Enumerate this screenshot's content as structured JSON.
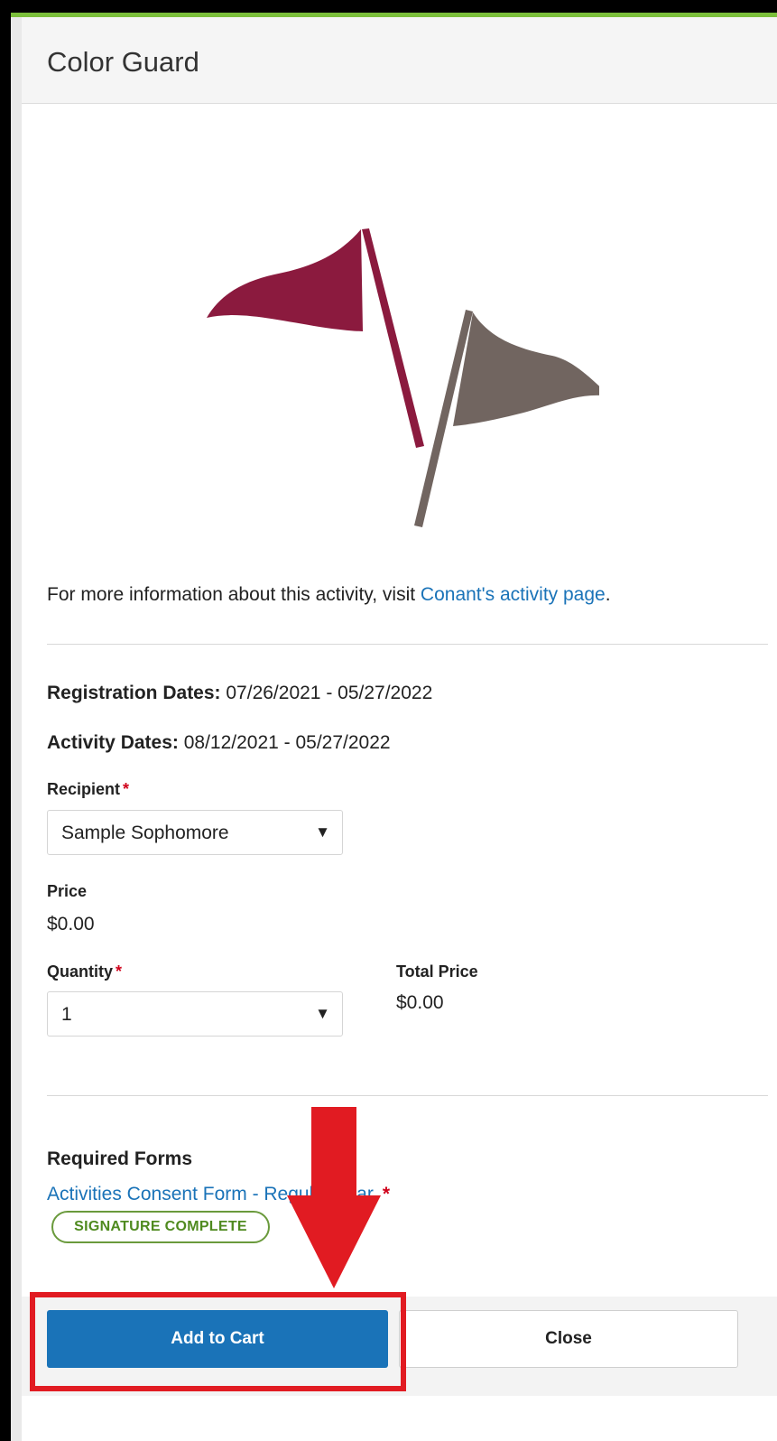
{
  "modal": {
    "title": "Color Guard",
    "info_prefix": "For more information about this activity, visit ",
    "info_link": "Conant's activity page",
    "info_suffix": "."
  },
  "registration": {
    "label": "Registration Dates:",
    "value": " 07/26/2021 - 05/27/2022"
  },
  "activity": {
    "label": "Activity Dates:",
    "value": " 08/12/2021 - 05/27/2022"
  },
  "recipient": {
    "label": "Recipient",
    "required": "*",
    "value": "Sample Sophomore"
  },
  "price": {
    "label": "Price",
    "value": "$0.00"
  },
  "quantity": {
    "label": "Quantity",
    "required": "*",
    "value": "1"
  },
  "total_price": {
    "label": "Total Price",
    "value": "$0.00"
  },
  "required_forms": {
    "heading": "Required Forms",
    "form_link": "Activities Consent Form - Regular Year",
    "form_required": "*",
    "status_badge": "SIGNATURE COMPLETE"
  },
  "footer": {
    "add_label": "Add to Cart",
    "close_label": "Close"
  },
  "colors": {
    "accent": "#1a73b8",
    "flag_maroon": "#8b1a3e",
    "flag_grey": "#716560",
    "annotation_red": "#e11b22",
    "complete_green": "#4f8a1f"
  },
  "icons": {
    "caret": "▼"
  }
}
